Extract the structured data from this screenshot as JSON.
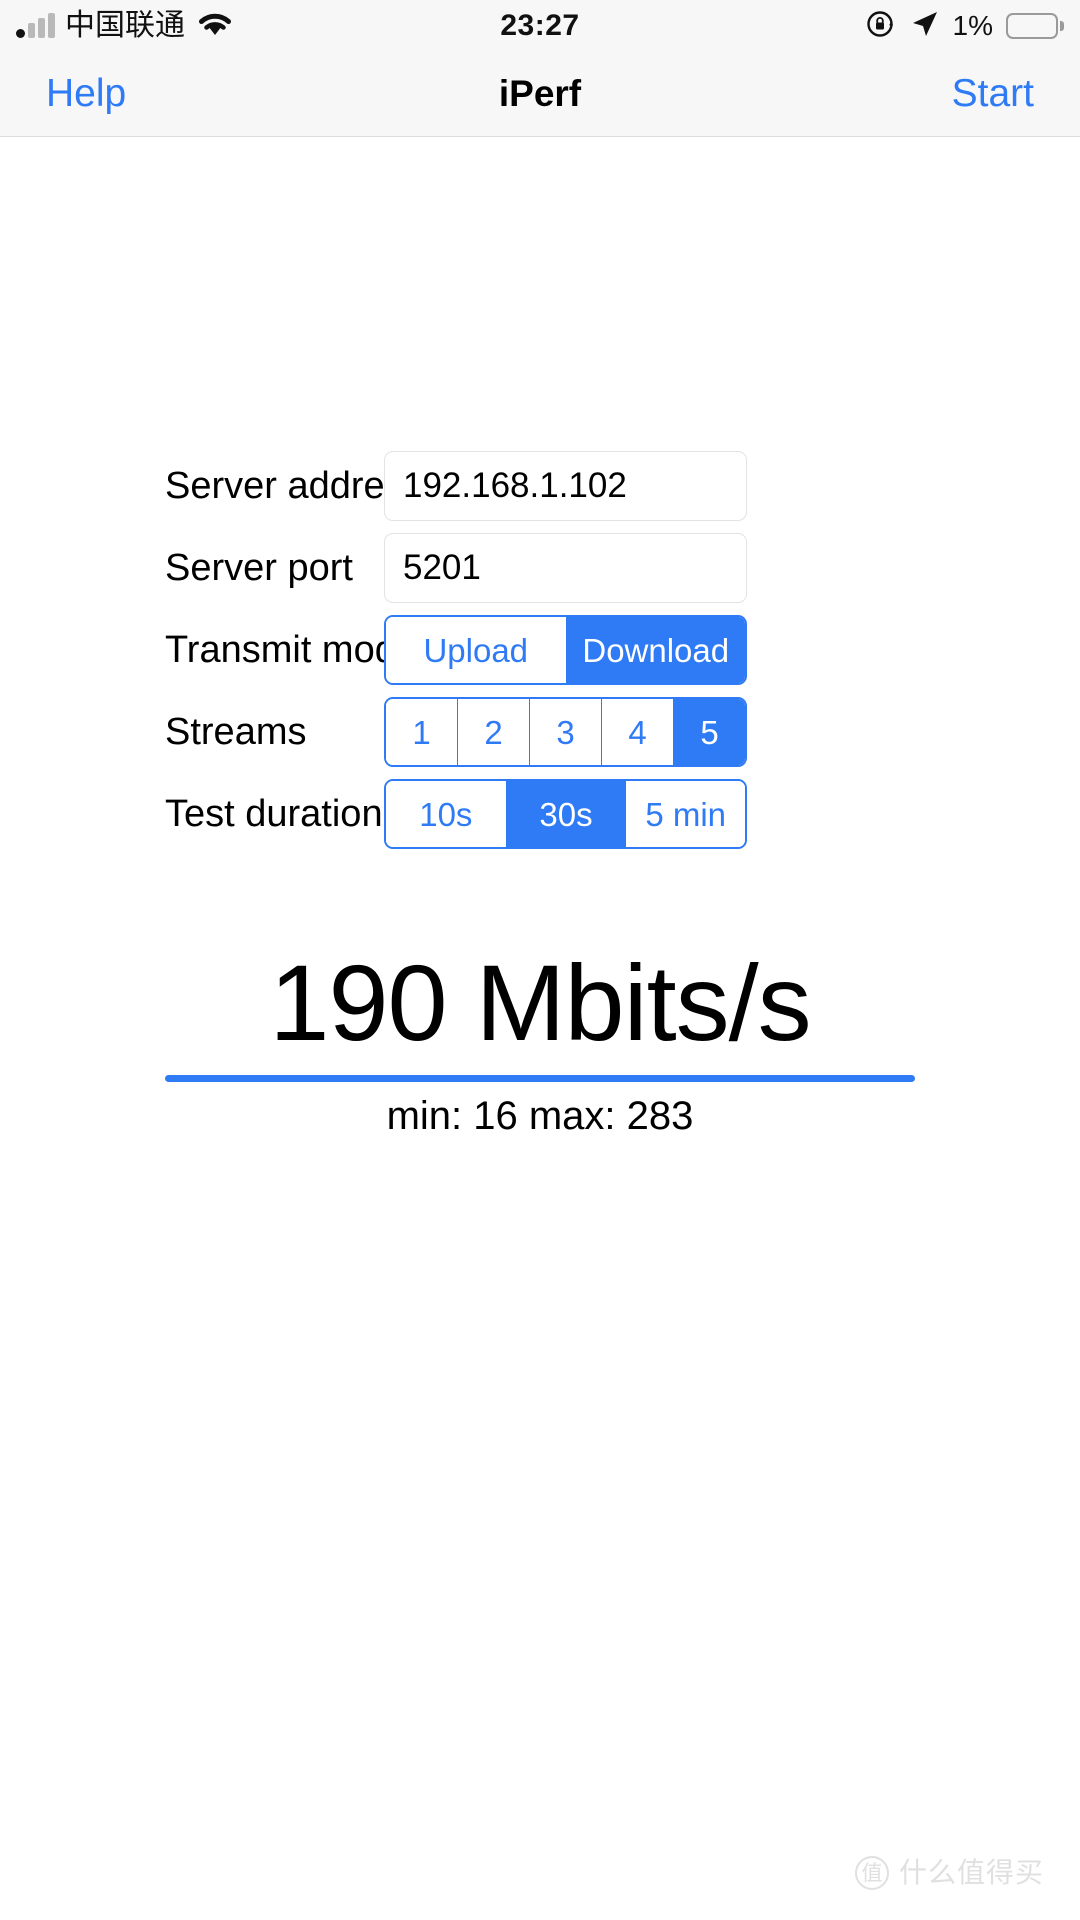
{
  "status_bar": {
    "carrier": "中国联通",
    "signal_icon": "cellular-signal-icon",
    "wifi_icon": "wifi-icon",
    "time": "23:27",
    "rotation_lock_icon": "rotation-lock-icon",
    "location_icon": "location-arrow-icon",
    "battery_percent": "1%",
    "battery_icon": "battery-icon",
    "battery_level": 1
  },
  "nav_bar": {
    "left_button": "Help",
    "title": "iPerf",
    "right_button": "Start",
    "accent_color": "#2f7bf6"
  },
  "form": {
    "rows": [
      {
        "label": "Server address",
        "type": "text",
        "value": "192.168.1.102",
        "placeholder": "Server address"
      },
      {
        "label": "Server port",
        "type": "text",
        "value": "5201",
        "placeholder": "Server port"
      },
      {
        "label": "Transmit mode",
        "type": "segmented",
        "options": [
          "Upload",
          "Download"
        ],
        "selected": "Download"
      },
      {
        "label": "Streams",
        "type": "segmented",
        "options": [
          "1",
          "2",
          "3",
          "4",
          "5"
        ],
        "selected": "5"
      },
      {
        "label": "Test duration",
        "type": "segmented",
        "options": [
          "10s",
          "30s",
          "5 min"
        ],
        "selected": "30s"
      }
    ]
  },
  "result": {
    "value": "190 Mbits/s",
    "throughput": 190,
    "unit": "Mbits/s",
    "min": 16,
    "max": 283,
    "summary": "min: 16 max: 283",
    "rule_color": "#2f7bf6"
  },
  "watermark": {
    "badge": "值",
    "text": "什么值得买"
  }
}
